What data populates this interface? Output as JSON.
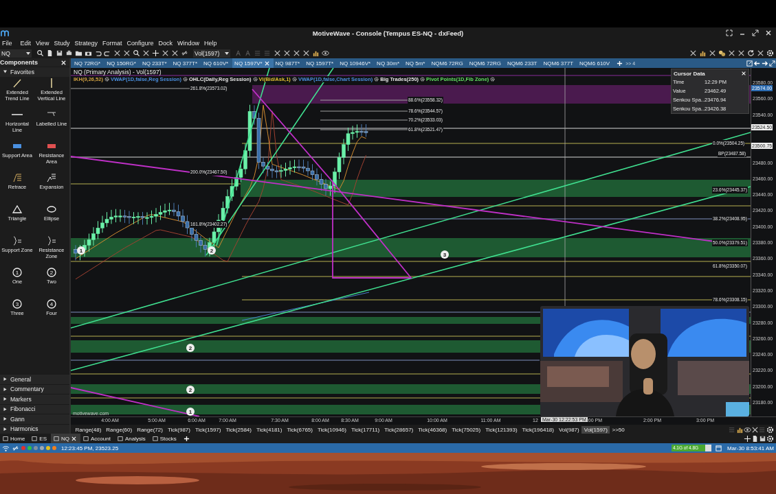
{
  "window": {
    "title": "MotiveWave - Console (Tempus ES-NQ - dxFeed)"
  },
  "menu": [
    "File",
    "Edit",
    "View",
    "Study",
    "Strategy",
    "Format",
    "Configure",
    "Dock",
    "Window",
    "Help"
  ],
  "toolbar": {
    "symbol": "NQ",
    "bar_size": "Vol(1597)"
  },
  "chart_tabs": [
    {
      "label": "NQ 72RG*",
      "selected": false
    },
    {
      "label": "NQ 150RG*",
      "selected": false
    },
    {
      "label": "NQ 233T*",
      "selected": false
    },
    {
      "label": "NQ 377T*",
      "selected": false
    },
    {
      "label": "NQ 610V*",
      "selected": false
    },
    {
      "label": "NQ 1597V*",
      "selected": true
    },
    {
      "label": "NQ 987T*",
      "selected": false
    },
    {
      "label": "NQ 1597T*",
      "selected": false
    },
    {
      "label": "NQ 10946V*",
      "selected": false
    },
    {
      "label": "NQ 30m*",
      "selected": false
    },
    {
      "label": "NQ 5m*",
      "selected": false
    },
    {
      "label": "NQM6 72RG",
      "selected": false
    },
    {
      "label": "NQM6 72RG",
      "selected": false
    },
    {
      "label": "NQM6 233T",
      "selected": false
    },
    {
      "label": "NQM6 377T",
      "selected": false
    },
    {
      "label": "NQM6 610V",
      "selected": false
    }
  ],
  "chart_tabs_more": ">> 4",
  "components": {
    "title": "Components",
    "favorites": "Favorites",
    "tools": [
      {
        "kind": "trend",
        "label": "Extended Trend Line"
      },
      {
        "kind": "vline",
        "label": "Extended Vertical Line"
      },
      {
        "kind": "hline",
        "label": "Horizontal Line"
      },
      {
        "kind": "labelled",
        "label": "Labelled Line"
      },
      {
        "kind": "support_area",
        "label": "Support Area"
      },
      {
        "kind": "resistance_area",
        "label": "Resistance Area"
      },
      {
        "kind": "retrace",
        "label": "Retrace"
      },
      {
        "kind": "expansion",
        "label": "Expansion"
      },
      {
        "kind": "triangle",
        "label": "Triangle"
      },
      {
        "kind": "ellipse",
        "label": "Ellipse"
      },
      {
        "kind": "zone",
        "label": "Support Zone"
      },
      {
        "kind": "zone",
        "label": "Resistance Zone"
      },
      {
        "kind": "number",
        "mark": "1",
        "label": "One"
      },
      {
        "kind": "number",
        "mark": "2",
        "label": "Two"
      },
      {
        "kind": "number",
        "mark": "3",
        "label": "Three"
      },
      {
        "kind": "number",
        "mark": "4",
        "label": "Four"
      }
    ],
    "groups": [
      "General",
      "Commentary",
      "Markers",
      "Fibonacci",
      "Gann",
      "Harmonics"
    ]
  },
  "chart": {
    "title": "NQ (Primary Analysis) - Vol(1597)",
    "studies": [
      {
        "label": "IKH(9,26,52)",
        "color": "#d0a040"
      },
      {
        "label": "VWAP(1D,false,Reg Session)",
        "color": "#4a90e0"
      },
      {
        "label": "OHLC(Daily,Reg Session)",
        "color": "#e8e8e8"
      },
      {
        "label": "VI(Bid/Ask,1)",
        "color": "#e0c030"
      },
      {
        "label": "VWAP(1D,false,Chart Session)",
        "color": "#4a90e0"
      },
      {
        "label": "Big Trades(250)",
        "color": "#e8e8e8"
      },
      {
        "label": "Pivot Points(1D,Fib Zone)",
        "color": "#60e060"
      }
    ],
    "levels": [
      "261.8%(23573.02)",
      "88.6%(23558.32)",
      "78.6%(23544.57)",
      "70.2%(23533.03)",
      "61.8%(23521.47)",
      "200.0%(23467.50)",
      "161.8%(23402.27)",
      "0.0%(23504.25)",
      "BP(23487.58)",
      "23.6%(23445.37)",
      "38.2%(23408.95)",
      "50.0%(23379.51)",
      "61.8%(23350.07)",
      "78.6%(23308.15)"
    ],
    "markers": [
      "1",
      "2",
      "3",
      "2",
      "2",
      "1"
    ],
    "credit": "motivewave.com"
  },
  "cursor_data": {
    "title": "Cursor Data",
    "rows": [
      {
        "label": "Time",
        "value": "12:29 PM"
      },
      {
        "label": "Value",
        "value": "23462.49"
      },
      {
        "label": "Senkou Spa...",
        "value": "23476.94"
      },
      {
        "label": "Senkou Spa...",
        "value": "23426.38"
      }
    ]
  },
  "price_axis": {
    "ticks": [
      "23580.00",
      "23560.00",
      "23540.00",
      "23480.00",
      "23460.00",
      "23440.00",
      "23420.00",
      "23400.00",
      "23380.00",
      "23360.00",
      "23340.00",
      "23320.00",
      "23300.00",
      "23280.00",
      "23260.00",
      "23240.00",
      "23220.00",
      "23200.00",
      "23180.00"
    ],
    "tags": [
      "23574.00",
      "23524.50",
      "23500.75"
    ]
  },
  "time_axis": {
    "labels": [
      "4:00 AM",
      "5:00 AM",
      "6:00 AM",
      "7:00 AM",
      "7:30 AM",
      "8:00 AM",
      "8:30 AM",
      "9:00 AM",
      "10:00 AM",
      "11:00 AM",
      "12",
      ":00 PM",
      "2:00 PM",
      "3:00 PM"
    ],
    "cursor": "Mar-30 12:22:53 PM"
  },
  "bar_sizes": [
    {
      "label": "Range(48)",
      "selected": false
    },
    {
      "label": "Range(60)",
      "selected": false
    },
    {
      "label": "Range(72)",
      "selected": false
    },
    {
      "label": "Tick(987)",
      "selected": false
    },
    {
      "label": "Tick(1597)",
      "selected": false
    },
    {
      "label": "Tick(2584)",
      "selected": false
    },
    {
      "label": "Tick(4181)",
      "selected": false
    },
    {
      "label": "Tick(6765)",
      "selected": false
    },
    {
      "label": "Tick(10946)",
      "selected": false
    },
    {
      "label": "Tick(17711)",
      "selected": false
    },
    {
      "label": "Tick(28657)",
      "selected": false
    },
    {
      "label": "Tick(46368)",
      "selected": false
    },
    {
      "label": "Tick(75025)",
      "selected": false
    },
    {
      "label": "Tick(121393)",
      "selected": false
    },
    {
      "label": "Tick(196418)",
      "selected": false
    },
    {
      "label": "Vol(987)",
      "selected": false
    },
    {
      "label": "Vol(1597)",
      "selected": true
    }
  ],
  "bar_sizes_more": ">>50",
  "doc_tabs": [
    {
      "label": "Home",
      "selected": false
    },
    {
      "label": "ES",
      "selected": false
    },
    {
      "label": "NQ",
      "selected": true
    },
    {
      "label": "Account",
      "selected": false
    },
    {
      "label": "Analysis",
      "selected": false
    },
    {
      "label": "Stocks",
      "selected": false
    }
  ],
  "status_bar": {
    "dots": [
      {
        "color": "#e03030"
      },
      {
        "color": "#30c040"
      },
      {
        "color": "#8090a0"
      },
      {
        "color": "#a0a8b0"
      },
      {
        "color": "#e0c020"
      },
      {
        "color": "#f08020"
      }
    ],
    "text": "12:23:45 PM, 23523.25",
    "memory": "4.1G of 4.8G",
    "level": 0.85,
    "clock": "Mar-30 8:53:41 AM"
  }
}
